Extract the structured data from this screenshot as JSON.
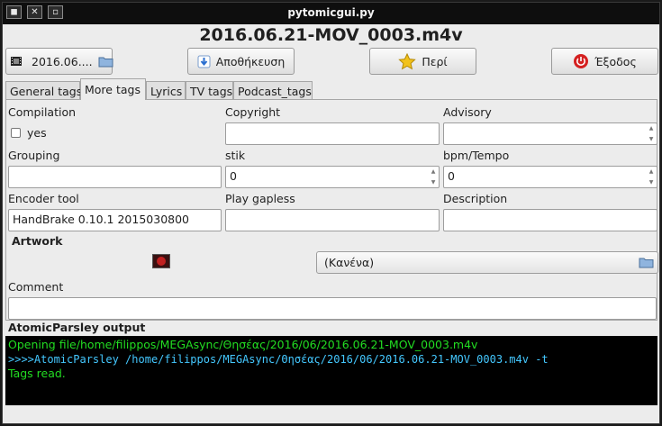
{
  "window": {
    "title": "pytomicgui.py"
  },
  "file_title": "2016.06.21-MOV_0003.m4v",
  "toolbar": {
    "file_button_label": "2016.06....",
    "save_label": "Αποθήκευση",
    "about_label": "Περί",
    "exit_label": "Έξοδος"
  },
  "tabs": [
    {
      "label": "General tags"
    },
    {
      "label": "More tags"
    },
    {
      "label": "Lyrics"
    },
    {
      "label": "TV tags"
    },
    {
      "label": "Podcast_tags"
    }
  ],
  "active_tab": "More tags",
  "fields": {
    "compilation": {
      "label": "Compilation",
      "checkbox_label": "yes",
      "checked": false
    },
    "copyright": {
      "label": "Copyright",
      "value": ""
    },
    "advisory": {
      "label": "Advisory",
      "value": ""
    },
    "grouping": {
      "label": "Grouping",
      "value": ""
    },
    "stik": {
      "label": "stik",
      "value": "0"
    },
    "bpm": {
      "label": "bpm/Tempo",
      "value": "0"
    },
    "encoder": {
      "label": "Encoder tool",
      "value": "HandBrake 0.10.1 2015030800"
    },
    "gapless": {
      "label": "Play gapless",
      "value": ""
    },
    "description": {
      "label": "Description",
      "value": ""
    },
    "artwork": {
      "label": "Artwork",
      "selected": "(Κανένα)"
    },
    "comment": {
      "label": "Comment",
      "value": ""
    }
  },
  "output": {
    "heading": "AtomicParsley output",
    "lines": [
      {
        "text": "Opening file/home/filippos/MEGAsync/Θησέας/2016/06/2016.06.21-MOV_0003.m4v",
        "color": "#22dd22"
      },
      {
        "text": ">>>>AtomicParsley /home/filippos/MEGAsync/Θησέας/2016/06/2016.06.21-MOV_0003.m4v -t",
        "color": "#44c8ff"
      },
      {
        "text": "Tags read.",
        "color": "#22dd22"
      }
    ]
  },
  "colors": {
    "console_bg": "#000000",
    "exit_icon": "#d42020",
    "save_icon": "#2b6fd0",
    "star_icon": "#f2c21a"
  }
}
